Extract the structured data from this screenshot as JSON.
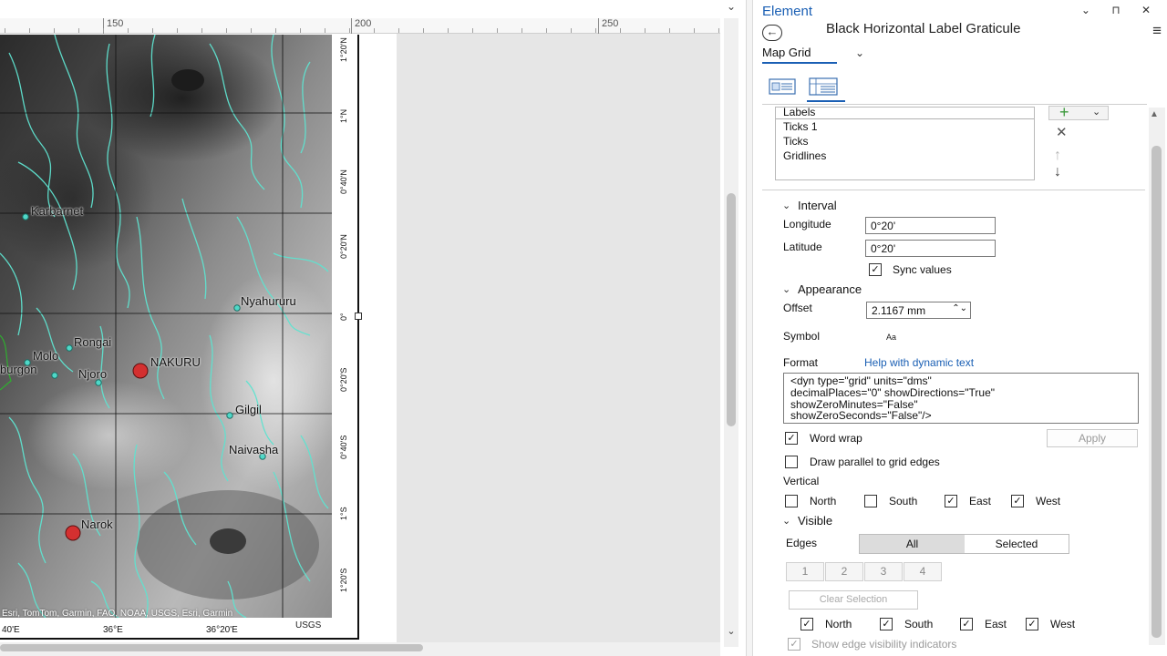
{
  "layout_view": {
    "ruler_labels": [
      "150",
      "200",
      "250"
    ],
    "lat_labels": [
      "1°20'N",
      "1°N",
      "0°40'N",
      "0°20'N",
      "0°",
      "0°20'S",
      "0°40'S",
      "1°S",
      "1°20'S"
    ],
    "lon_labels": [
      "40'E",
      "36°E",
      "36°20'E"
    ],
    "attribution": "Esri, TomTom, Garmin, FAO, NOAA, USGS, Esri, Garmin",
    "usgs": "USGS",
    "cities": [
      {
        "name": "Karbarnet",
        "capital": false
      },
      {
        "name": "Nyahururu",
        "capital": false
      },
      {
        "name": "Rongai",
        "capital": false
      },
      {
        "name": "Molo",
        "capital": false
      },
      {
        "name": "burgon",
        "capital": false
      },
      {
        "name": "Njoro",
        "capital": false
      },
      {
        "name": "NAKURU",
        "capital": true
      },
      {
        "name": "Gilgil",
        "capital": false
      },
      {
        "name": "Naivasha",
        "capital": false
      },
      {
        "name": "Narok",
        "capital": true
      }
    ]
  },
  "pane": {
    "title": "Element",
    "window_buttons": "⌄ ⊓ ✕",
    "element_name": "Black Horizontal Label Graticule",
    "element_type": "Map Grid",
    "components": [
      "Labels",
      "Ticks 1",
      "Ticks",
      "Gridlines"
    ],
    "interval": {
      "heading": "Interval",
      "longitude_label": "Longitude",
      "longitude_value": "0°20'",
      "latitude_label": "Latitude",
      "latitude_value": "0°20'",
      "sync_label": "Sync values",
      "sync_checked": true
    },
    "appearance": {
      "heading": "Appearance",
      "offset_label": "Offset",
      "offset_value": "2.1167 mm",
      "symbol_label": "Symbol",
      "symbol_preview": "Aa",
      "format_label": "Format",
      "help_link": "Help with dynamic text",
      "format_text": "<dyn type=\"grid\" units=\"dms\"\ndecimalPlaces=\"0\" showDirections=\"True\"\nshowZeroMinutes=\"False\"\nshowZeroSeconds=\"False\"/>",
      "word_wrap_label": "Word wrap",
      "word_wrap_checked": true,
      "apply_label": "Apply",
      "parallel_label": "Draw parallel to grid edges",
      "parallel_checked": false,
      "vertical_label": "Vertical",
      "vertical": [
        {
          "label": "North",
          "checked": false
        },
        {
          "label": "South",
          "checked": false
        },
        {
          "label": "East",
          "checked": true
        },
        {
          "label": "West",
          "checked": true
        }
      ]
    },
    "visible": {
      "heading": "Visible",
      "edges_label": "Edges",
      "seg_all": "All",
      "seg_selected": "Selected",
      "edge_numbers": [
        "1",
        "2",
        "3",
        "4"
      ],
      "clear_label": "Clear Selection",
      "edges": [
        {
          "label": "North",
          "checked": true
        },
        {
          "label": "South",
          "checked": true
        },
        {
          "label": "East",
          "checked": true
        },
        {
          "label": "West",
          "checked": true
        }
      ],
      "show_indicators_label": "Show edge visibility indicators",
      "show_indicators_checked": true
    }
  },
  "colors": {
    "accent": "#1a5fb4",
    "river": "#5fe3d0",
    "city_dot": "#4fd8c8",
    "capital": "#d43030",
    "add_green": "#3c9a3c"
  }
}
